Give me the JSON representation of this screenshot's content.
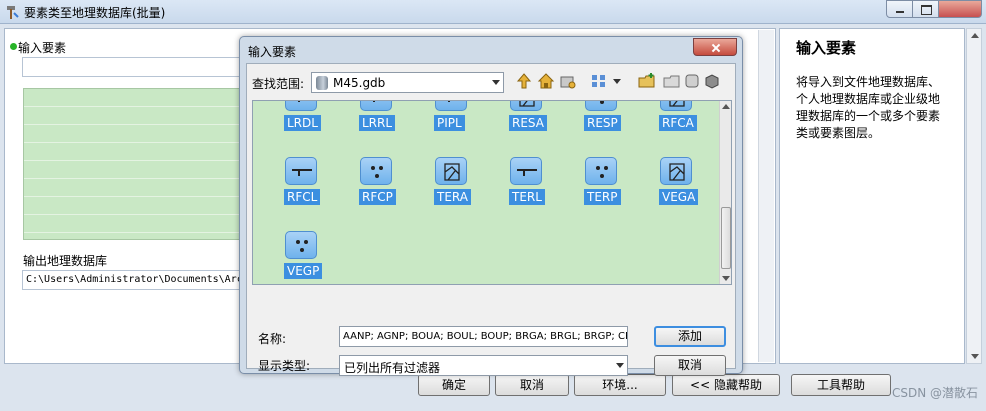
{
  "window": {
    "title": "要素类至地理数据库(批量)"
  },
  "form": {
    "input_label": "输入要素",
    "output_label": "输出地理数据库",
    "output_value": "C:\\Users\\Administrator\\Documents\\Arc"
  },
  "help": {
    "title": "输入要素",
    "body": "将导入到文件地理数据库、个人地理数据库或企业级地理数据库的一个或多个要素类或要素图层。"
  },
  "buttons": {
    "ok": "确定",
    "cancel": "取消",
    "env": "环境...",
    "hide_help": "<< 隐藏帮助",
    "tool_help": "工具帮助"
  },
  "dialog": {
    "title": "输入要素",
    "look_in_label": "查找范围:",
    "look_in_value": "M45.gdb",
    "top_row": [
      {
        "name": "LRDL",
        "icon": "line-feature-icon"
      },
      {
        "name": "LRRL",
        "icon": "line-feature-icon"
      },
      {
        "name": "PIPL",
        "icon": "line-feature-icon"
      },
      {
        "name": "RESA",
        "icon": "polygon-feature-icon"
      },
      {
        "name": "RESP",
        "icon": "point-feature-icon"
      },
      {
        "name": "RFCA",
        "icon": "polygon-feature-icon"
      }
    ],
    "items": [
      {
        "name": "RFCL",
        "icon": "line-feature-icon"
      },
      {
        "name": "RFCP",
        "icon": "point-feature-icon"
      },
      {
        "name": "TERA",
        "icon": "polygon-feature-icon"
      },
      {
        "name": "TERL",
        "icon": "line-feature-icon"
      },
      {
        "name": "TERP",
        "icon": "point-feature-icon"
      },
      {
        "name": "VEGA",
        "icon": "polygon-feature-icon"
      },
      {
        "name": "VEGP",
        "icon": "point-feature-icon"
      }
    ],
    "name_label": "名称:",
    "name_value": "AANP; AGNP; BOUA; BOUL; BOUP; BRGA; BRGL; BRGP; CPT",
    "type_label": "显示类型:",
    "type_value": "已列出所有过滤器",
    "add_button": "添加",
    "cancel_button": "取消"
  },
  "watermark": "CSDN @潜散石"
}
